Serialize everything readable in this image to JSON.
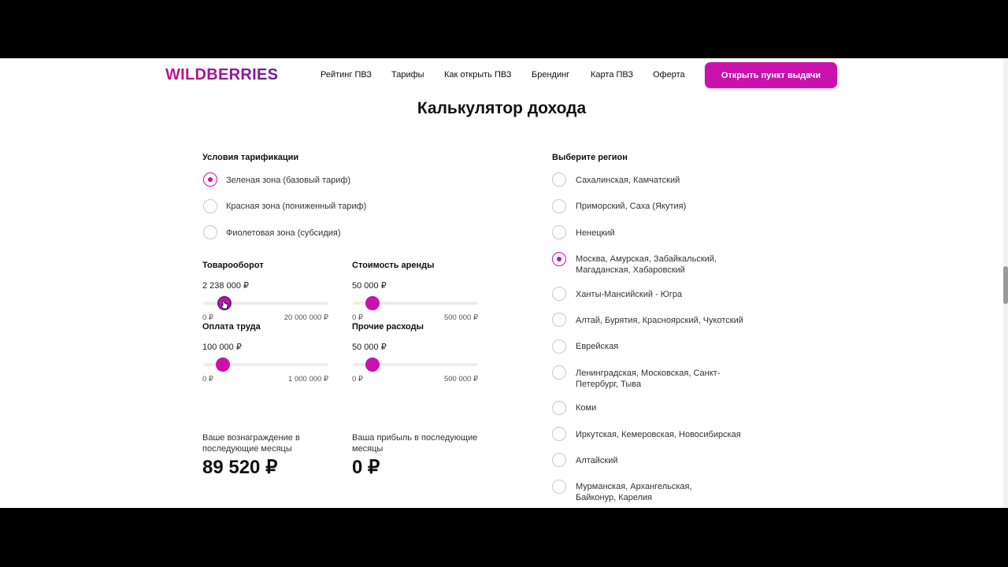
{
  "header": {
    "logo": "WILDBERRIES",
    "nav": [
      "Рейтинг ПВЗ",
      "Тарифы",
      "Как открыть ПВЗ",
      "Брендинг",
      "Карта ПВЗ",
      "Оферта"
    ],
    "cta": "Открыть пункт выдачи"
  },
  "title": "Калькулятор дохода",
  "tariff": {
    "label": "Условия тарификации",
    "options": [
      "Зеленая зона (базовый тариф)",
      "Красная зона (пониженный тариф)",
      "Фиолетовая зона (субсидия)"
    ],
    "selected": 0
  },
  "sliders": {
    "turnover": {
      "label": "Товарооборот",
      "value": "2 238 000 ₽",
      "min": "0 ₽",
      "max": "20 000 000 ₽"
    },
    "rent": {
      "label": "Стоимость аренды",
      "value": "50 000 ₽",
      "min": "0 ₽",
      "max": "500 000 ₽"
    },
    "salary": {
      "label": "Оплата труда",
      "value": "100 000 ₽",
      "min": "0 ₽",
      "max": "1 000 000 ₽"
    },
    "other": {
      "label": "Прочие расходы",
      "value": "50 000 ₽",
      "min": "0 ₽",
      "max": "500 000 ₽"
    }
  },
  "results": {
    "reward_label": "Ваше вознаграждение в последующие месяцы",
    "reward_value": "89 520 ₽",
    "profit_label": "Ваша прибыль в последующие месяцы",
    "profit_value": "0 ₽"
  },
  "region": {
    "label": "Выберите регион",
    "options": [
      "Сахалинская, Камчатский",
      "Приморский, Саха (Якутия)",
      "Ненецкий",
      "Москва, Амурская, Забайкальский, Магаданская, Хабаровский",
      "Ханты-Мансийский - Югра",
      "Алтай, Бурятия, Красноярский, Чукотский",
      "Еврейская",
      "Ленинградская, Московская, Санкт-Петербург, Тыва",
      "Коми",
      "Иркутская, Кемеровская, Новосибирская",
      "Алтайский",
      "Мурманская, Архангельская, Байконур, Карелия"
    ],
    "selected": 3
  },
  "colors": {
    "accent": "#cb11ab",
    "brand_gradient_end": "#6a1b9a"
  }
}
